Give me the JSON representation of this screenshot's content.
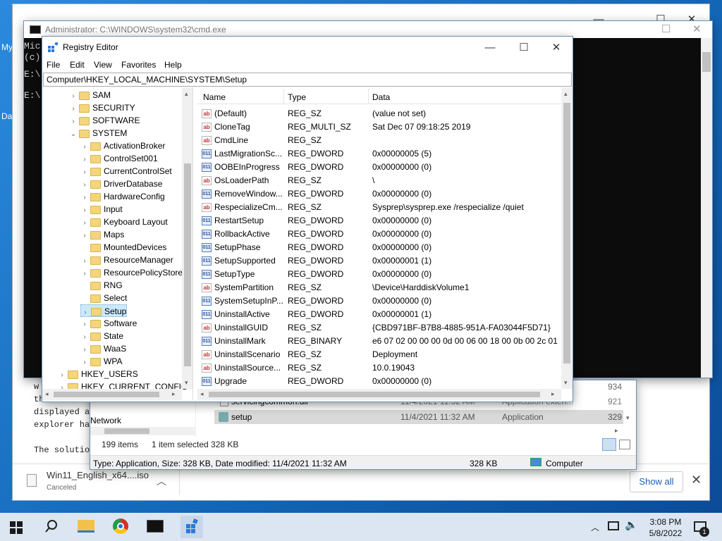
{
  "desktop": {
    "icon1_label": "My",
    "icon2_label": "Da"
  },
  "cmd": {
    "title": "Administrator: C:\\WINDOWS\\system32\\cmd.exe",
    "lines": [
      "Mic",
      "(c)",
      "",
      "E:\\",
      "",
      "E:\\"
    ]
  },
  "explorer": {
    "files": [
      {
        "name": "servicingcommon.dll",
        "date": "11/4/2021 11:32 AM",
        "type": "Application exten...",
        "size": "921"
      },
      {
        "name": "setup",
        "date": "11/4/2021 11:32 AM",
        "type": "Application",
        "size": "329"
      }
    ],
    "size_top": "934",
    "nav_network": "Network",
    "status_items": "199 items",
    "status_selected": "1 item selected  328 KB",
    "details_text": "Type: Application, Size: 328 KB, Date modified: 11/4/2021 11:32 AM",
    "details_size": "328 KB",
    "details_location": "Computer"
  },
  "bg_text": {
    "lines": [
      "w",
      "the",
      "displayed a",
      "explorer ha",
      "",
      "The solution"
    ]
  },
  "regedit": {
    "title": "Registry Editor",
    "menu": [
      "File",
      "Edit",
      "View",
      "Favorites",
      "Help"
    ],
    "address": "Computer\\HKEY_LOCAL_MACHINE\\SYSTEM\\Setup",
    "columns": {
      "name": "Name",
      "type": "Type",
      "data": "Data"
    },
    "tree": [
      {
        "label": "SAM",
        "arrow": "›"
      },
      {
        "label": "SECURITY",
        "arrow": "›"
      },
      {
        "label": "SOFTWARE",
        "arrow": "›"
      },
      {
        "label": "SYSTEM",
        "arrow": "⌄"
      },
      {
        "label": "ActivationBroker",
        "arrow": "›"
      },
      {
        "label": "ControlSet001",
        "arrow": "›"
      },
      {
        "label": "CurrentControlSet",
        "arrow": "›"
      },
      {
        "label": "DriverDatabase",
        "arrow": "›"
      },
      {
        "label": "HardwareConfig",
        "arrow": "›"
      },
      {
        "label": "Input",
        "arrow": "›"
      },
      {
        "label": "Keyboard Layout",
        "arrow": "›"
      },
      {
        "label": "Maps",
        "arrow": "›"
      },
      {
        "label": "MountedDevices",
        "arrow": ""
      },
      {
        "label": "ResourceManager",
        "arrow": "›"
      },
      {
        "label": "ResourcePolicyStore",
        "arrow": "›"
      },
      {
        "label": "RNG",
        "arrow": ""
      },
      {
        "label": "Select",
        "arrow": ""
      },
      {
        "label": "Setup",
        "arrow": "›"
      },
      {
        "label": "Software",
        "arrow": "›"
      },
      {
        "label": "State",
        "arrow": "›"
      },
      {
        "label": "WaaS",
        "arrow": "›"
      },
      {
        "label": "WPA",
        "arrow": "›"
      },
      {
        "label": "HKEY_USERS",
        "arrow": "›"
      },
      {
        "label": "HKEY_CURRENT_CONFIG",
        "arrow": "›"
      }
    ],
    "values": [
      {
        "icon": "ab",
        "name": "(Default)",
        "type": "REG_SZ",
        "data": "(value not set)"
      },
      {
        "icon": "ab",
        "name": "CloneTag",
        "type": "REG_MULTI_SZ",
        "data": "Sat Dec 07 09:18:25 2019"
      },
      {
        "icon": "ab",
        "name": "CmdLine",
        "type": "REG_SZ",
        "data": ""
      },
      {
        "icon": "bin",
        "name": "LastMigrationSc...",
        "type": "REG_DWORD",
        "data": "0x00000005 (5)"
      },
      {
        "icon": "bin",
        "name": "OOBEInProgress",
        "type": "REG_DWORD",
        "data": "0x00000000 (0)"
      },
      {
        "icon": "ab",
        "name": "OsLoaderPath",
        "type": "REG_SZ",
        "data": "\\"
      },
      {
        "icon": "bin",
        "name": "RemoveWindow...",
        "type": "REG_DWORD",
        "data": "0x00000000 (0)"
      },
      {
        "icon": "ab",
        "name": "RespecializeCm...",
        "type": "REG_SZ",
        "data": "Sysprep\\sysprep.exe /respecialize /quiet"
      },
      {
        "icon": "bin",
        "name": "RestartSetup",
        "type": "REG_DWORD",
        "data": "0x00000000 (0)"
      },
      {
        "icon": "bin",
        "name": "RollbackActive",
        "type": "REG_DWORD",
        "data": "0x00000000 (0)"
      },
      {
        "icon": "bin",
        "name": "SetupPhase",
        "type": "REG_DWORD",
        "data": "0x00000000 (0)"
      },
      {
        "icon": "bin",
        "name": "SetupSupported",
        "type": "REG_DWORD",
        "data": "0x00000001 (1)"
      },
      {
        "icon": "bin",
        "name": "SetupType",
        "type": "REG_DWORD",
        "data": "0x00000000 (0)"
      },
      {
        "icon": "ab",
        "name": "SystemPartition",
        "type": "REG_SZ",
        "data": "\\Device\\HarddiskVolume1"
      },
      {
        "icon": "bin",
        "name": "SystemSetupInP...",
        "type": "REG_DWORD",
        "data": "0x00000000 (0)"
      },
      {
        "icon": "bin",
        "name": "UninstallActive",
        "type": "REG_DWORD",
        "data": "0x00000001 (1)"
      },
      {
        "icon": "ab",
        "name": "UninstallGUID",
        "type": "REG_SZ",
        "data": "{CBD971BF-B7B8-4885-951A-FA03044F5D71}"
      },
      {
        "icon": "bin",
        "name": "UninstallMark",
        "type": "REG_BINARY",
        "data": "e6 07 02 00 00 00 0d 00 06 00 18 00 0b 00 2c 01"
      },
      {
        "icon": "ab",
        "name": "UninstallScenario",
        "type": "REG_SZ",
        "data": "Deployment"
      },
      {
        "icon": "ab",
        "name": "UninstallSource...",
        "type": "REG_SZ",
        "data": "10.0.19043"
      },
      {
        "icon": "bin",
        "name": "Upgrade",
        "type": "REG_DWORD",
        "data": "0x00000000 (0)"
      }
    ]
  },
  "download": {
    "filename": "Win11_English_x64....iso",
    "status": "Canceled",
    "show_all": "Show all"
  },
  "taskbar": {
    "time": "3:08 PM",
    "date": "5/8/2022",
    "notif_count": "1"
  }
}
